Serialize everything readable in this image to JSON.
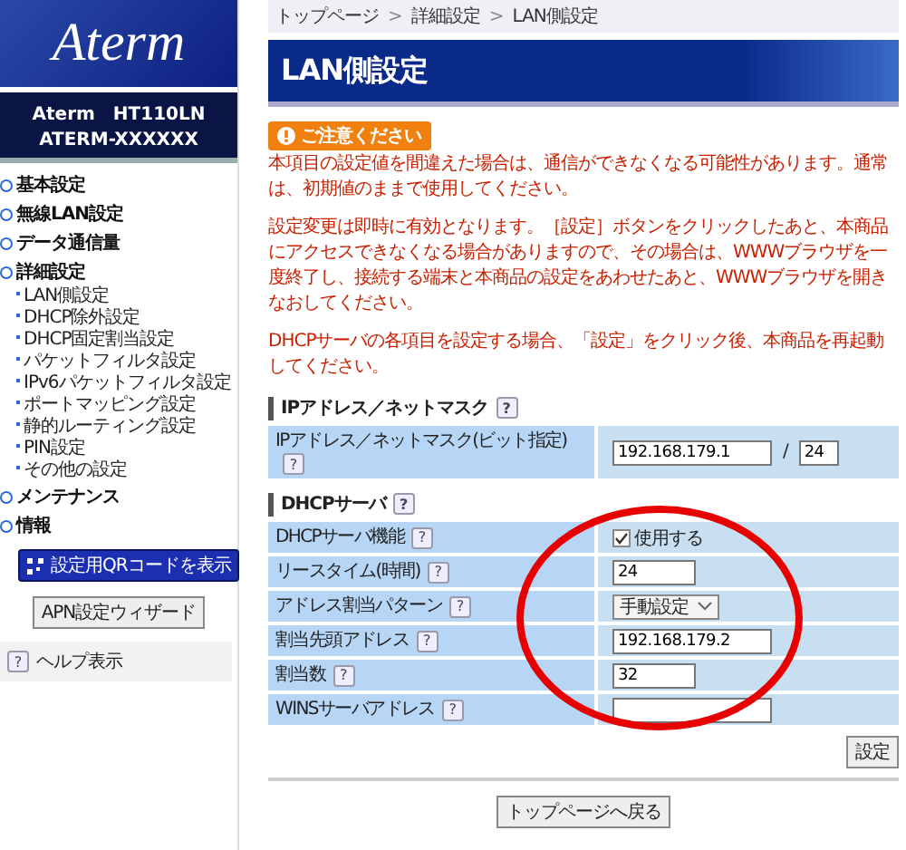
{
  "sidebar": {
    "logo": "Aterm",
    "model": "Aterm　HT110LN",
    "device_name": "ATERM-XXXXXX",
    "items": [
      {
        "label": "基本設定"
      },
      {
        "label": "無線LAN設定"
      },
      {
        "label": "データ通信量"
      },
      {
        "label": "詳細設定",
        "children": [
          {
            "label": "LAN側設定"
          },
          {
            "label": "DHCP除外設定"
          },
          {
            "label": "DHCP固定割当設定"
          },
          {
            "label": "パケットフィルタ設定"
          },
          {
            "label": "IPv6パケットフィルタ設定"
          },
          {
            "label": "ポートマッピング設定"
          },
          {
            "label": "静的ルーティング設定"
          },
          {
            "label": "PIN設定"
          },
          {
            "label": "その他の設定"
          }
        ]
      },
      {
        "label": "メンテナンス"
      },
      {
        "label": "情報"
      }
    ],
    "qr_button": "設定用QRコードを表示",
    "apn_button": "APN設定ウィザード",
    "help_mark": "?",
    "help": "ヘルプ表示"
  },
  "breadcrumb": [
    {
      "kind": "link",
      "text": "トップページ"
    },
    {
      "kind": "separator",
      "text": ">"
    },
    {
      "kind": "link",
      "text": "詳細設定"
    },
    {
      "kind": "separator",
      "text": ">"
    },
    {
      "kind": "link",
      "text": "LAN側設定"
    }
  ],
  "title": "LAN側設定",
  "notice": {
    "label": "ご注意ください",
    "paragraphs": [
      "本項目の設定値を間違えた場合は、通信ができなくなる可能性があります。通常は、初期値のままで使用してください。",
      "設定変更は即時に有効となります。［設定］ボタンをクリックしたあと、本商品にアクセスできなくなる場合がありますので、その場合は、WWWブラウザを一度終了し、接続する端末と本商品の設定をあわせたあと、WWWブラウザを開きなおしてください。",
      "DHCPサーバの各項目を設定する場合、「設定」をクリック後、本商品を再起動してください。"
    ]
  },
  "sections": [
    {
      "title": "IPアドレス／ネットマスク",
      "help_mark": "?",
      "rows": [
        {
          "label": "IPアドレス／ネットマスク(ビット指定)",
          "help_mark": "?",
          "kind": "ipmask",
          "value": "192.168.179.1",
          "separator": "/",
          "mask": "24"
        }
      ]
    },
    {
      "title": "DHCPサーバ",
      "help_mark": "?",
      "rows": [
        {
          "label": "DHCPサーバ機能",
          "help_mark": "?",
          "kind": "checkbox",
          "value": "使用する",
          "checked": true
        },
        {
          "label": "リースタイム(時間)",
          "help_mark": "?",
          "kind": "short_input",
          "value": "24"
        },
        {
          "label": "アドレス割当パターン",
          "help_mark": "?",
          "kind": "select",
          "value": "手動設定"
        },
        {
          "label": "割当先頭アドレス",
          "help_mark": "?",
          "kind": "address_input",
          "value": "192.168.179.2"
        },
        {
          "label": "割当数",
          "help_mark": "?",
          "kind": "short_input",
          "value": "32"
        },
        {
          "label": "WINSサーバアドレス",
          "help_mark": "?",
          "kind": "address_input",
          "value": ""
        }
      ]
    }
  ],
  "submit": "設定",
  "back": "トップページへ戻る"
}
